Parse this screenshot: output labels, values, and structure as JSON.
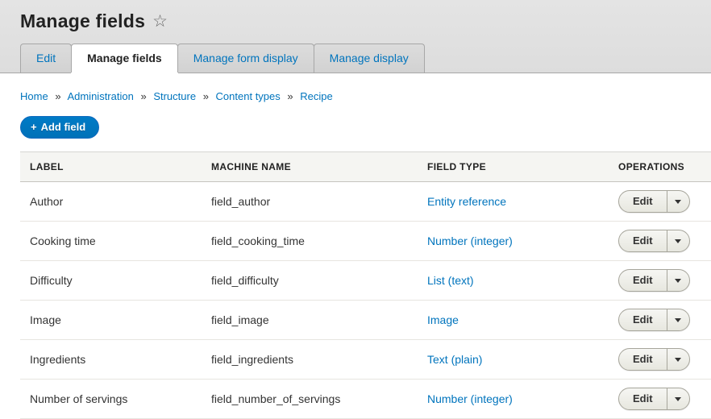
{
  "page": {
    "title": "Manage fields",
    "star_icon": "☆"
  },
  "tabs": [
    {
      "label": "Edit"
    },
    {
      "label": "Manage fields"
    },
    {
      "label": "Manage form display"
    },
    {
      "label": "Manage display"
    }
  ],
  "breadcrumb": {
    "separator": "»",
    "items": [
      "Home",
      "Administration",
      "Structure",
      "Content types",
      "Recipe"
    ]
  },
  "add_field": {
    "icon": "+",
    "label": "Add field"
  },
  "table": {
    "headers": [
      "LABEL",
      "MACHINE NAME",
      "FIELD TYPE",
      "OPERATIONS"
    ],
    "edit_label": "Edit",
    "rows": [
      {
        "label": "Author",
        "machine_name": "field_author",
        "field_type": "Entity reference"
      },
      {
        "label": "Cooking time",
        "machine_name": "field_cooking_time",
        "field_type": "Number (integer)"
      },
      {
        "label": "Difficulty",
        "machine_name": "field_difficulty",
        "field_type": "List (text)"
      },
      {
        "label": "Image",
        "machine_name": "field_image",
        "field_type": "Image"
      },
      {
        "label": "Ingredients",
        "machine_name": "field_ingredients",
        "field_type": "Text (plain)"
      },
      {
        "label": "Number of servings",
        "machine_name": "field_number_of_servings",
        "field_type": "Number (integer)"
      }
    ]
  },
  "colors": {
    "link": "#0074bd",
    "primary_button": "#0071b8",
    "header_bg": "#e0e0e0"
  }
}
